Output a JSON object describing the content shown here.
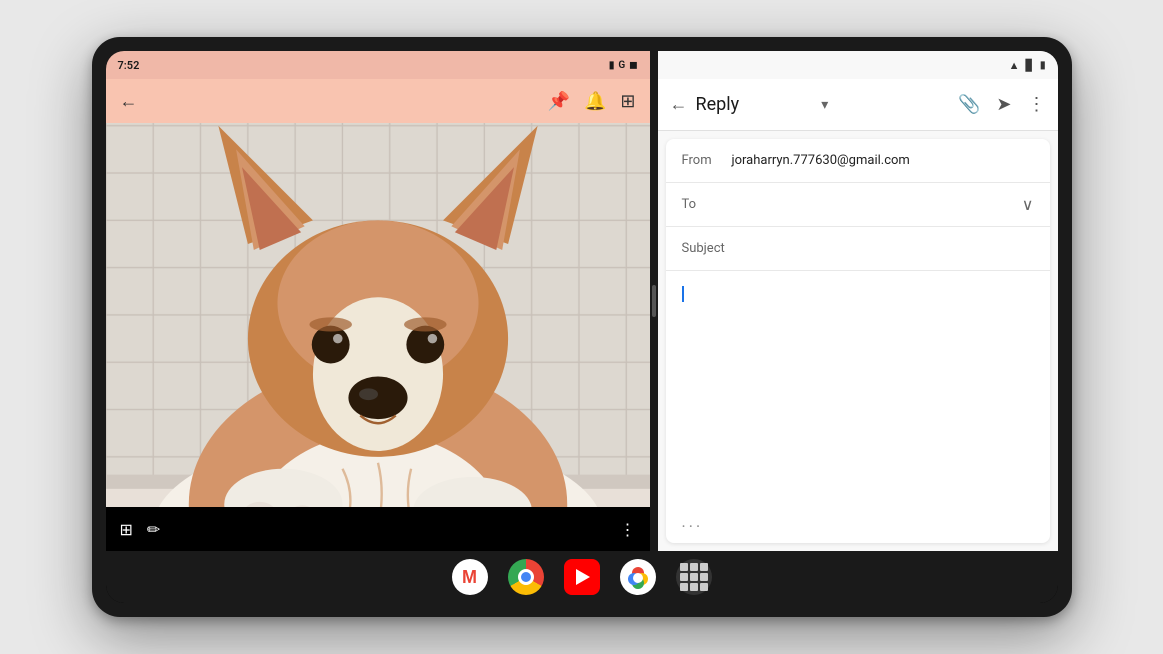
{
  "tablet": {
    "left_panel": {
      "status_bar": {
        "time": "7:52",
        "icons": [
          "battery",
          "G",
          "data"
        ]
      },
      "toolbar": {
        "back_label": "←",
        "icons": [
          "pin",
          "bell",
          "add-photo"
        ]
      },
      "photo_alt": "Corgi dog in bathtub"
    },
    "right_panel": {
      "status_bar": {
        "icons": [
          "wifi",
          "signal",
          "battery"
        ]
      },
      "toolbar": {
        "back_label": "←",
        "title": "Reply",
        "dropdown_icon": "▾",
        "icons": [
          "attach",
          "send",
          "more"
        ]
      },
      "compose": {
        "from_label": "From",
        "from_value": "joraharryn.777630@gmail.com",
        "to_label": "To",
        "to_expand_icon": "∨",
        "subject_label": "Subject",
        "body_placeholder": "",
        "ellipsis": "..."
      }
    },
    "taskbar": {
      "apps": [
        {
          "name": "gmail",
          "label": "Gmail"
        },
        {
          "name": "chrome",
          "label": "Chrome"
        },
        {
          "name": "youtube",
          "label": "YouTube"
        },
        {
          "name": "photos",
          "label": "Google Photos"
        },
        {
          "name": "launcher",
          "label": "All Apps"
        }
      ]
    }
  }
}
